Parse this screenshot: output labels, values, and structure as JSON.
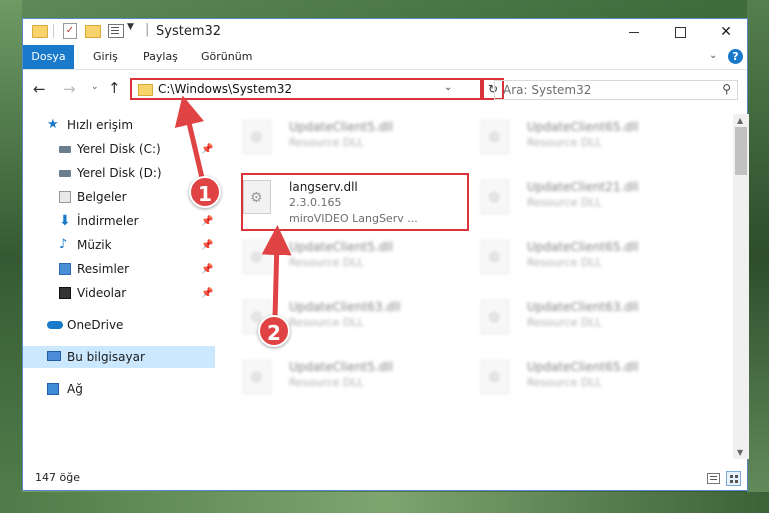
{
  "window": {
    "title": "System32",
    "quick_access_icons": [
      "folder-icon",
      "properties-check-icon",
      "new-folder-icon",
      "properties-icon"
    ],
    "controls": {
      "minimize": "minimize-icon",
      "maximize": "maximize-icon",
      "close": "✕"
    }
  },
  "ribbon": {
    "tabs": [
      {
        "label": "Dosya"
      },
      {
        "label": "Giriş"
      },
      {
        "label": "Paylaş"
      },
      {
        "label": "Görünüm"
      }
    ],
    "help": "?"
  },
  "nav": {
    "address": "C:\\Windows\\System32",
    "search_placeholder": "Ara: System32"
  },
  "sidebar": {
    "items": [
      {
        "label": "Hızlı erişim",
        "icon": "star-icon",
        "pinned": false
      },
      {
        "label": "Yerel Disk (C:)",
        "icon": "disk-icon",
        "pinned": true
      },
      {
        "label": "Yerel Disk (D:)",
        "icon": "disk-icon",
        "pinned": false
      },
      {
        "label": "Belgeler",
        "icon": "documents-icon",
        "pinned": false
      },
      {
        "label": "İndirmeler",
        "icon": "download-icon",
        "pinned": true
      },
      {
        "label": "Müzik",
        "icon": "music-icon",
        "pinned": true
      },
      {
        "label": "Resimler",
        "icon": "pictures-icon",
        "pinned": true
      },
      {
        "label": "Videolar",
        "icon": "video-icon",
        "pinned": true
      },
      {
        "label": "OneDrive",
        "icon": "cloud-icon",
        "pinned": false
      },
      {
        "label": "Bu bilgisayar",
        "icon": "pc-icon",
        "pinned": false,
        "selected": true
      },
      {
        "label": "Ağ",
        "icon": "network-icon",
        "pinned": false
      }
    ]
  },
  "files": {
    "highlighted": {
      "name": "langserv.dll",
      "version": "2.3.0.165",
      "description": "miroVIDEO LangServ ..."
    },
    "blurred": [
      {
        "name": "UpdateClient5.dll",
        "type": "Resource DLL"
      },
      {
        "name": "UpdateClient65.dll",
        "type": "Resource DLL"
      },
      {
        "name": "UpdateClient21.dll",
        "type": "Resource DLL"
      },
      {
        "name": "UpdateClient5.dll",
        "type": "Resource DLL"
      },
      {
        "name": "UpdateClient65.dll",
        "type": "Resource DLL"
      },
      {
        "name": "UpdateClient63.dll",
        "type": "Resource DLL"
      },
      {
        "name": "UpdateClient63.dll",
        "type": "Resource DLL"
      },
      {
        "name": "UpdateClient5.dll",
        "type": "Resource DLL"
      },
      {
        "name": "UpdateClient65.dll",
        "type": "Resource DLL"
      }
    ]
  },
  "annotations": {
    "badge_1": "1",
    "badge_2": "2",
    "accent_color": "#d9343a"
  },
  "status": {
    "item_count": "147 öğe"
  }
}
